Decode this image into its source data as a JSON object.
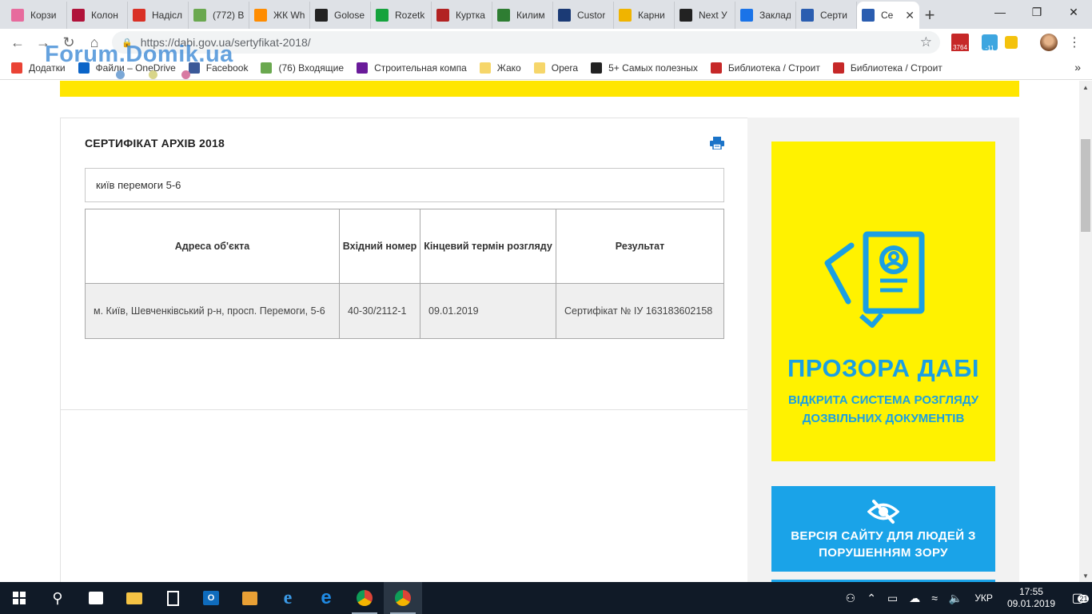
{
  "browser": {
    "tabs": [
      {
        "label": "Корзи",
        "icon": "ribbon-icon",
        "color": "#e76b9d"
      },
      {
        "label": "Колон",
        "icon": "exclamation-icon",
        "color": "#b0123a"
      },
      {
        "label": "Надісл",
        "icon": "gmail-icon",
        "color": "#d93025"
      },
      {
        "label": "(772) В",
        "icon": "mail-icon",
        "color": "#6aa84f"
      },
      {
        "label": "ЖК Wh",
        "icon": "square-icon",
        "color": "#ff8c00"
      },
      {
        "label": "Golose",
        "icon": "wl-icon",
        "color": "#222222"
      },
      {
        "label": "Rozetk",
        "icon": "rozetka-icon",
        "color": "#15a33d"
      },
      {
        "label": "Куртка",
        "icon": "hat-icon",
        "color": "#b22222"
      },
      {
        "label": "Килим",
        "icon": "image-icon",
        "color": "#2e7d32"
      },
      {
        "label": "Custor",
        "icon": "ps-icon",
        "color": "#1b3a75"
      },
      {
        "label": "Карни",
        "icon": "helmet-icon",
        "color": "#f0b400"
      },
      {
        "label": "Next У",
        "icon": "arch-icon",
        "color": "#222222"
      },
      {
        "label": "Заклад",
        "icon": "star-icon",
        "color": "#1a73e8"
      },
      {
        "label": "Серти",
        "icon": "globe-icon",
        "color": "#2a5db0"
      },
      {
        "label": "Се",
        "icon": "globe-icon",
        "color": "#2a5db0",
        "active": true
      }
    ],
    "new_tab": "+",
    "url": "https://dabi.gov.ua/sertyfikat-2018/",
    "extensions": [
      {
        "name": "gmail-extension",
        "badge": "3764",
        "color": "#c62828"
      },
      {
        "name": "inbox-extension",
        "badge": "-11",
        "color": "#3ea6e0"
      },
      {
        "name": "save-extension",
        "badge": "",
        "color": "#f4c20d"
      }
    ]
  },
  "bookmarks": [
    {
      "label": "Додатки",
      "icon": "apps-icon",
      "color": "#ea4335"
    },
    {
      "label": "Файли – OneDrive",
      "icon": "cloud-icon",
      "color": "#0a64c8"
    },
    {
      "label": "Facebook",
      "icon": "facebook-icon",
      "color": "#3b5998"
    },
    {
      "label": "(76) Входящие",
      "icon": "mail-icon",
      "color": "#6aa84f"
    },
    {
      "label": "Строительная компа",
      "icon": "square-icon",
      "color": "#6a1b9a"
    },
    {
      "label": "Жако",
      "icon": "folder-icon",
      "color": "#f6d66a"
    },
    {
      "label": "Opera",
      "icon": "folder-icon",
      "color": "#f6d66a"
    },
    {
      "label": "5+ Самых полезных",
      "icon": "blog-icon",
      "color": "#222222"
    },
    {
      "label": "Библиотека / Строит",
      "icon": "m-icon",
      "color": "#c62828"
    },
    {
      "label": "Библиотека / Строит",
      "icon": "m-icon",
      "color": "#c62828"
    }
  ],
  "watermark": "Forum.Domik.ua",
  "main": {
    "title": "СЕРТИФІКАТ АРХІВ 2018",
    "search_value": "київ перемоги 5-6",
    "table": {
      "headers": [
        "Адреса об'єкта",
        "Вхідний номер",
        "Кінцевий термін розгляду",
        "Результат"
      ],
      "rows": [
        [
          "м. Київ, Шевченківський р-н, просп. Перемоги, 5-6",
          "40-30/2112-1",
          "09.01.2019",
          "Сертифікат № ІУ 163183602158"
        ]
      ]
    }
  },
  "sidebar": {
    "banner1_title": "ПРОЗОРА ДАБІ",
    "banner1_sub_line1": "ВІДКРИТА СИСТЕМА РОЗГЛЯДУ",
    "banner1_sub_line2": "ДОЗВІЛЬНИХ ДОКУМЕНТІВ",
    "banner2_line1": "ВЕРСІЯ САЙТУ ДЛЯ ЛЮДЕЙ З",
    "banner2_line2": "ПОРУШЕННЯМ ЗОРУ"
  },
  "taskbar": {
    "language": "УКР",
    "time": "17:55",
    "date": "09.01.2019",
    "notifications": "21"
  },
  "colors": {
    "accent_yellow": "#fff200",
    "accent_blue": "#1aa3e8",
    "taskbar": "#101a27"
  }
}
